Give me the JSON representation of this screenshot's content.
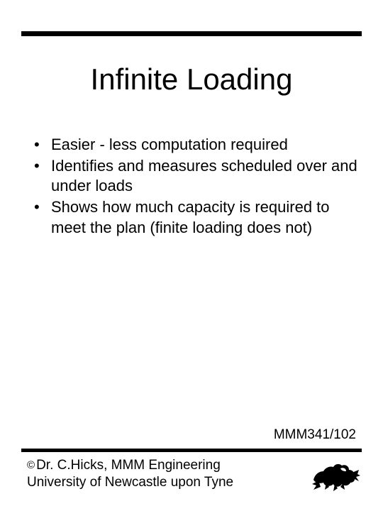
{
  "title": "Infinite Loading",
  "bullets": [
    "Easier - less computation required",
    "Identifies and measures scheduled over and under loads",
    "Shows how much capacity is required to meet the plan (finite loading does not)"
  ],
  "slide_code": "MMM341/102",
  "footer": {
    "copyright_symbol": "©",
    "line1": "Dr. C.Hicks, MMM Engineering",
    "line2": "University of Newcastle upon Tyne"
  },
  "crest_alt": "lion-crest-icon"
}
